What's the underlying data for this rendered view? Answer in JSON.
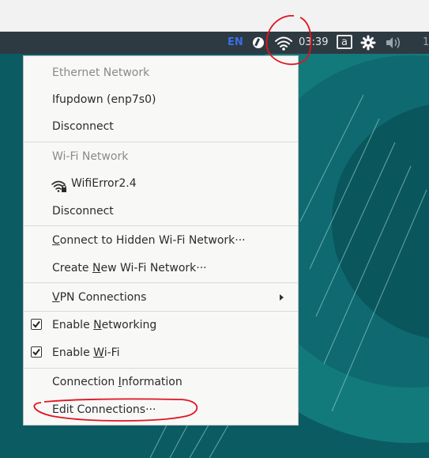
{
  "panel": {
    "lang": "EN",
    "time": "03:39",
    "kbd": "a",
    "edge": "1"
  },
  "menu": {
    "ethernet_header": "Ethernet Network",
    "ethernet_connection": "Ifupdown (enp7s0)",
    "ethernet_disconnect": "Disconnect",
    "wifi_header": "Wi-Fi Network",
    "wifi_network": "WifiError2.4",
    "wifi_disconnect": "Disconnect",
    "hidden_pre": "",
    "hidden_u": "C",
    "hidden_post": "onnect to Hidden Wi-Fi Network···",
    "create_pre": "Create ",
    "create_u": "N",
    "create_post": "ew Wi-Fi Network···",
    "vpn_u": "V",
    "vpn_post": "PN Connections",
    "enable_networking_pre": "Enable ",
    "enable_networking_u": "N",
    "enable_networking_post": "etworking",
    "enable_networking_checked": true,
    "enable_wifi_pre": "Enable ",
    "enable_wifi_u": "W",
    "enable_wifi_post": "i-Fi",
    "enable_wifi_checked": true,
    "info_pre": "Connection ",
    "info_u": "I",
    "info_post": "nformation",
    "edit_pre": "Edit Connections···"
  },
  "icons": {
    "panel": [
      "no-entry-icon",
      "wifi-icon",
      "keyboard-icon",
      "settings-gear-icon",
      "volume-icon"
    ],
    "menu": [
      "wifi-lock-icon",
      "checkbox-checked-icon",
      "submenu-arrow-icon"
    ]
  },
  "colors": {
    "panel_bg": "#2e3a42",
    "desktop_bg": "#0b5b63",
    "menu_bg": "#f8f8f7",
    "lang_accent": "#3a6ee8",
    "annotation_red": "#e0141e"
  }
}
